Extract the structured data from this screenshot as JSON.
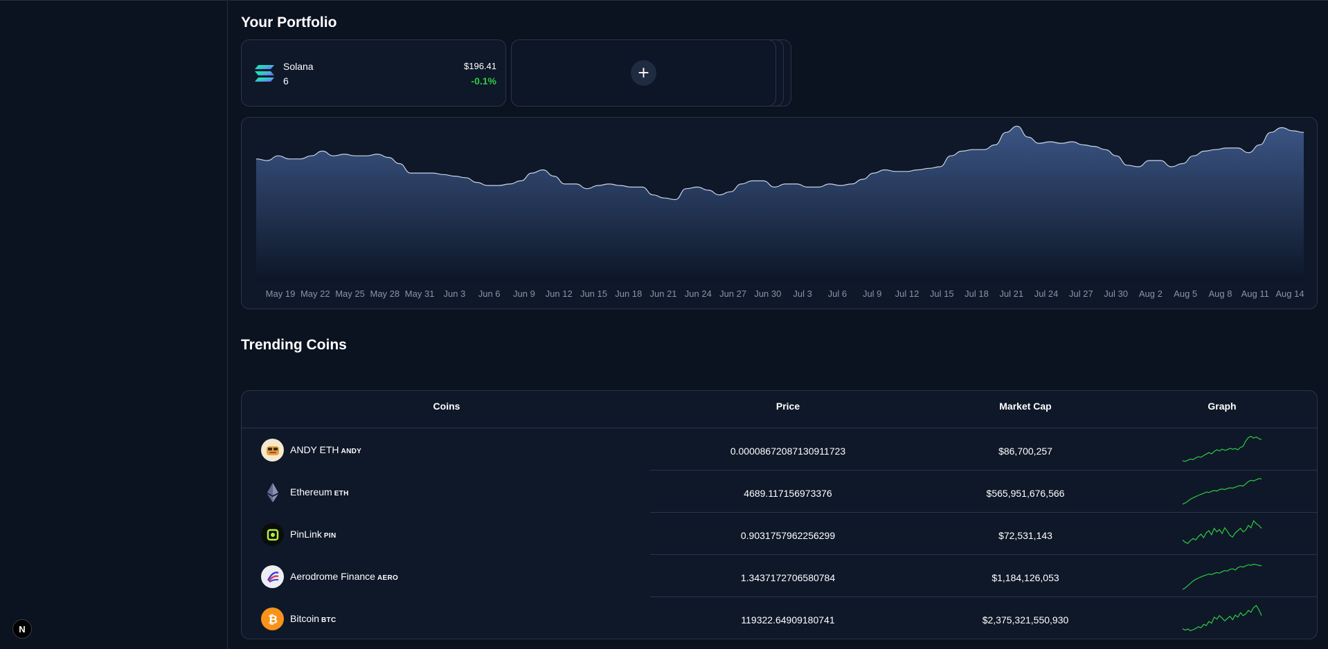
{
  "sidebar": {
    "badge_label": "N"
  },
  "portfolio": {
    "title": "Your Portfolio",
    "assets": [
      {
        "name": "Solana",
        "quantity": "6",
        "price": "$196.41",
        "change": "-0.1%",
        "icon": "solana-icon"
      }
    ],
    "add_label": "+"
  },
  "chart_data": {
    "type": "area",
    "x_tick_labels": [
      "May 19",
      "May 22",
      "May 25",
      "May 28",
      "May 31",
      "Jun 3",
      "Jun 6",
      "Jun 9",
      "Jun 12",
      "Jun 15",
      "Jun 18",
      "Jun 21",
      "Jun 24",
      "Jun 27",
      "Jun 30",
      "Jul 3",
      "Jul 6",
      "Jul 9",
      "Jul 12",
      "Jul 15",
      "Jul 18",
      "Jul 21",
      "Jul 24",
      "Jul 27",
      "Jul 30",
      "Aug 2",
      "Aug 5",
      "Aug 8",
      "Aug 11",
      "Aug 14"
    ],
    "values": [
      0.78,
      0.77,
      0.8,
      0.78,
      0.78,
      0.8,
      0.83,
      0.8,
      0.81,
      0.8,
      0.8,
      0.81,
      0.79,
      0.75,
      0.69,
      0.69,
      0.69,
      0.68,
      0.67,
      0.66,
      0.63,
      0.61,
      0.61,
      0.62,
      0.64,
      0.69,
      0.71,
      0.67,
      0.62,
      0.62,
      0.59,
      0.61,
      0.62,
      0.61,
      0.6,
      0.6,
      0.55,
      0.53,
      0.52,
      0.59,
      0.6,
      0.58,
      0.55,
      0.57,
      0.62,
      0.64,
      0.64,
      0.6,
      0.62,
      0.62,
      0.6,
      0.6,
      0.62,
      0.61,
      0.62,
      0.65,
      0.69,
      0.71,
      0.7,
      0.7,
      0.71,
      0.72,
      0.73,
      0.8,
      0.83,
      0.84,
      0.84,
      0.87,
      0.95,
      0.99,
      0.92,
      0.88,
      0.89,
      0.88,
      0.89,
      0.87,
      0.86,
      0.84,
      0.8,
      0.74,
      0.73,
      0.77,
      0.77,
      0.73,
      0.75,
      0.8,
      0.83,
      0.84,
      0.85,
      0.85,
      0.82,
      0.87,
      0.95,
      0.98,
      0.96,
      0.95
    ],
    "ylim": [
      0,
      1
    ],
    "grid": false,
    "colors": {
      "line": "#cbd5e6",
      "fill_top": "#3b5584",
      "fill_bottom": "#0d1628",
      "tick": "#8a94a6"
    }
  },
  "trending": {
    "title": "Trending Coins",
    "columns": [
      "Coins",
      "Price",
      "Market Cap",
      "Graph"
    ],
    "coins": [
      {
        "name": "ANDY ETH",
        "symbol": "ANDY",
        "price": "0.00008672087130911723",
        "market_cap": "$86,700,257",
        "logo": "andy-logo",
        "spark": [
          0.12,
          0.1,
          0.14,
          0.18,
          0.16,
          0.22,
          0.26,
          0.24,
          0.3,
          0.35,
          0.4,
          0.36,
          0.44,
          0.5,
          0.46,
          0.52,
          0.48,
          0.5,
          0.55,
          0.52,
          0.54,
          0.5,
          0.58,
          0.62,
          0.8,
          0.92,
          0.96,
          0.9,
          0.94,
          0.88,
          0.85
        ]
      },
      {
        "name": "Ethereum",
        "symbol": "ETH",
        "price": "4689.117156973376",
        "market_cap": "$565,951,676,566",
        "logo": "ethereum-icon",
        "spark": [
          0.08,
          0.12,
          0.18,
          0.25,
          0.3,
          0.34,
          0.38,
          0.42,
          0.45,
          0.5,
          0.48,
          0.52,
          0.55,
          0.53,
          0.58,
          0.6,
          0.58,
          0.62,
          0.64,
          0.63,
          0.66,
          0.7,
          0.72,
          0.7,
          0.78,
          0.86,
          0.9,
          0.88,
          0.92,
          0.96,
          0.95
        ]
      },
      {
        "name": "PinLink",
        "symbol": "PIN",
        "price": "0.9031757962256299",
        "market_cap": "$72,531,143",
        "logo": "pinlink-icon",
        "spark": [
          0.3,
          0.22,
          0.18,
          0.28,
          0.35,
          0.3,
          0.42,
          0.5,
          0.38,
          0.55,
          0.62,
          0.48,
          0.7,
          0.58,
          0.66,
          0.52,
          0.72,
          0.6,
          0.46,
          0.4,
          0.54,
          0.62,
          0.7,
          0.58,
          0.64,
          0.8,
          0.72,
          0.96,
          0.86,
          0.8,
          0.7
        ]
      },
      {
        "name": "Aerodrome Finance",
        "symbol": "AERO",
        "price": "1.3437172706580784",
        "market_cap": "$1,184,126,053",
        "logo": "aerodrome-icon",
        "spark": [
          0.05,
          0.1,
          0.18,
          0.26,
          0.34,
          0.4,
          0.44,
          0.48,
          0.52,
          0.55,
          0.58,
          0.56,
          0.6,
          0.63,
          0.61,
          0.66,
          0.7,
          0.68,
          0.74,
          0.76,
          0.72,
          0.8,
          0.84,
          0.82,
          0.86,
          0.9,
          0.88,
          0.92,
          0.9,
          0.88,
          0.86
        ]
      },
      {
        "name": "Bitcoin",
        "symbol": "BTC",
        "price": "119322.64909180741",
        "market_cap": "$2,375,321,550,930",
        "logo": "bitcoin-icon",
        "spark": [
          0.15,
          0.1,
          0.14,
          0.08,
          0.12,
          0.16,
          0.22,
          0.18,
          0.3,
          0.26,
          0.4,
          0.34,
          0.55,
          0.48,
          0.6,
          0.52,
          0.42,
          0.5,
          0.58,
          0.46,
          0.62,
          0.55,
          0.7,
          0.6,
          0.66,
          0.78,
          0.72,
          0.88,
          0.95,
          0.8,
          0.6
        ]
      }
    ]
  }
}
